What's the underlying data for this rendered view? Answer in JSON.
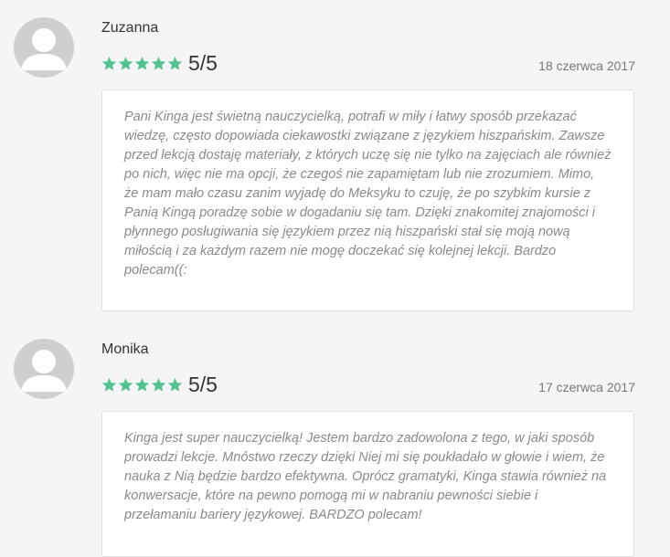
{
  "reviews": [
    {
      "author": "Zuzanna",
      "score": "5/5",
      "date": "18 czerwca 2017",
      "text": "Pani Kinga jest świetną nauczycielką, potrafi w miły i łatwy sposób przekazać wiedzę, często dopowiada ciekawostki związane z językiem hiszpańskim. Zawsze przed lekcją dostaję materiały, z których uczę się nie tylko na zajęciach ale również po nich, więc nie ma opcji, że czegoś nie zapamiętam lub nie zrozumiem. Mimo, że mam mało czasu zanim wyjadę do Meksyku to czuję, że po szybkim kursie z Panią Kingą poradzę sobie w dogadaniu się tam. Dzięki znakomitej znajomości i płynnego posługiwania się językiem przez nią hiszpański stał się moją nową miłością i za każdym razem nie mogę doczekać się kolejnej lekcji. Bardzo polecam((:",
      "stars": 5
    },
    {
      "author": "Monika",
      "score": "5/5",
      "date": "17 czerwca 2017",
      "text": "Kinga jest super nauczycielką! Jestem bardzo zadowolona z tego, w jaki sposób prowadzi lekcje. Mnóstwo rzeczy dzięki Niej mi się poukładało w głowie i wiem, że nauka z Nią będzie bardzo efektywna. Oprócz gramatyki, Kinga stawia również na konwersacje, które na pewno pomogą mi w nabraniu pewności siebie i przełamaniu bariery językowej. BARDZO polecam!",
      "stars": 5
    }
  ],
  "colors": {
    "star": "#52c28e",
    "avatar_bg": "#cfcfcf"
  },
  "icons": {
    "avatar": "user-avatar-icon",
    "star": "star-icon"
  }
}
